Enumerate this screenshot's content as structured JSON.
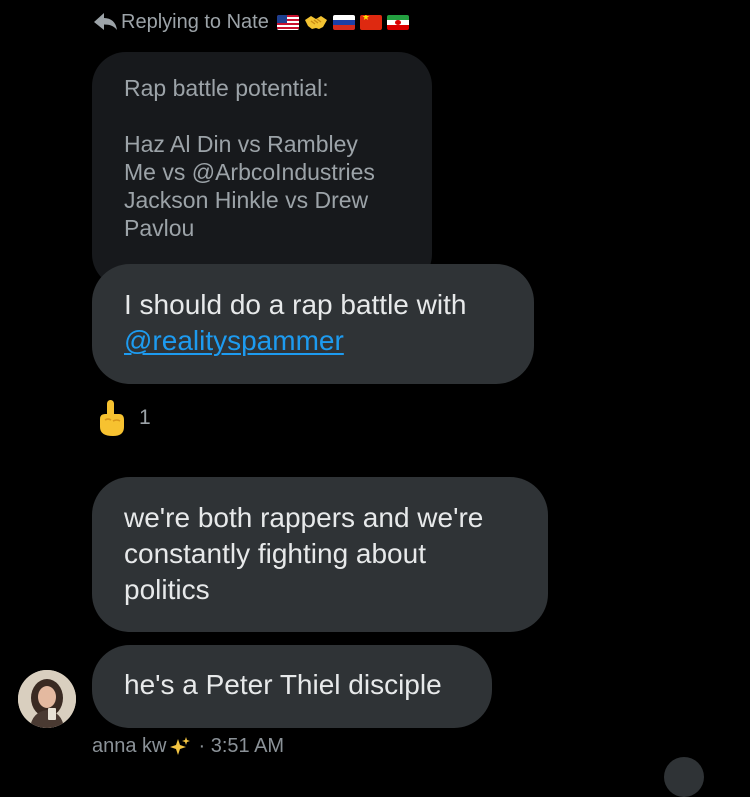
{
  "reply_context": {
    "label": "Replying to Nate",
    "emoji": [
      "us-flag",
      "handshake",
      "russia-flag",
      "china-flag",
      "iran-flag"
    ]
  },
  "quoted_message": {
    "lines": [
      "Rap battle potential:",
      "",
      "Haz Al Din vs Rambley",
      "Me vs @ArbcoIndustries",
      "Jackson Hinkle vs Drew",
      "Pavlou"
    ]
  },
  "messages": [
    {
      "text_before": "I should do a rap battle with",
      "mention": "@realityspammer"
    },
    {
      "lines": [
        "we're both rappers and we're",
        "constantly fighting about",
        "politics"
      ]
    },
    {
      "text": "he's a Peter Thiel disciple"
    }
  ],
  "reaction": {
    "emoji": "pointing-up-hand",
    "count": "1"
  },
  "sender": {
    "name": "anna kw",
    "name_emoji": "sparkles",
    "time": "· 3:51 AM"
  },
  "colors": {
    "background": "#000000",
    "bubble": "#2f3336",
    "quoted_bubble": "#17191c",
    "text": "#e7e9ea",
    "muted_text": "#9ca3a8",
    "link": "#1d9bf0"
  }
}
